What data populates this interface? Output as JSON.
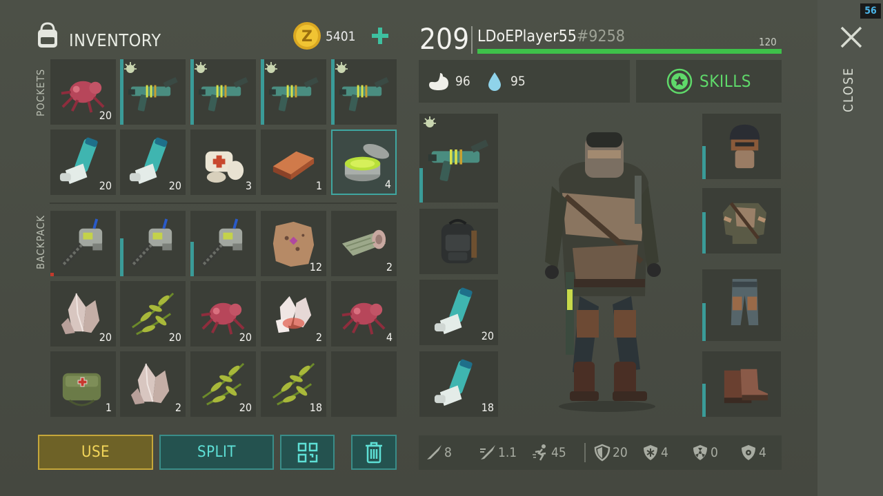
{
  "inventory": {
    "title": "INVENTORY",
    "coins": "5401",
    "pockets_label": "POCKETS",
    "backpack_label": "BACKPACK",
    "pockets": [
      {
        "item": "spider-creature-icon",
        "count": "20"
      },
      {
        "item": "rifle-icon",
        "count": "",
        "level": true
      },
      {
        "item": "rifle-icon",
        "count": "",
        "level": true
      },
      {
        "item": "rifle-icon",
        "count": "",
        "level": true
      },
      {
        "item": "rifle-icon",
        "count": "",
        "level": true
      },
      {
        "item": "inhaler-icon",
        "count": "20"
      },
      {
        "item": "inhaler-icon",
        "count": "20"
      },
      {
        "item": "bandage-icon",
        "count": "3"
      },
      {
        "item": "copper-ingot-icon",
        "count": "1"
      },
      {
        "item": "ointment-jar-icon",
        "count": "4",
        "selected": true
      }
    ],
    "backpack": [
      {
        "item": "chainsaw-icon",
        "count": ""
      },
      {
        "item": "chainsaw-icon",
        "count": ""
      },
      {
        "item": "chainsaw-icon",
        "count": ""
      },
      {
        "item": "leather-hide-icon",
        "count": "12"
      },
      {
        "item": "fabric-roll-icon",
        "count": "2"
      },
      {
        "item": "quartz-crystal-icon",
        "count": "20"
      },
      {
        "item": "herb-bundle-icon",
        "count": "20"
      },
      {
        "item": "spider-creature-icon",
        "count": "20"
      },
      {
        "item": "salt-crystal-icon",
        "count": "2"
      },
      {
        "item": "spider-creature-icon",
        "count": "4"
      },
      {
        "item": "medkit-bag-icon",
        "count": "1"
      },
      {
        "item": "quartz-crystal-icon",
        "count": "2"
      },
      {
        "item": "herb-bundle-icon",
        "count": "20"
      },
      {
        "item": "herb-bundle-icon",
        "count": "18"
      },
      {
        "item": "empty",
        "count": ""
      }
    ]
  },
  "actions": {
    "use": "USE",
    "split": "SPLIT"
  },
  "player": {
    "level": "209",
    "name": "LDoEPlayer55",
    "tag": "#9258",
    "xp_label": "120",
    "xp_fraction": 1.0,
    "food": "96",
    "water": "95",
    "skills_label": "SKILLS"
  },
  "equipment": {
    "left": [
      {
        "item": "rifle-icon",
        "count": ""
      },
      {
        "item": "backpack-icon",
        "count": ""
      },
      {
        "item": "inhaler-icon",
        "count": "20"
      },
      {
        "item": "inhaler-icon",
        "count": "18"
      }
    ],
    "right": [
      "helmet-icon",
      "armored-jacket-icon",
      "armored-pants-icon",
      "boots-icon"
    ]
  },
  "stats": {
    "damage": "8",
    "attack_speed": "1.1",
    "speed": "45",
    "armor": "20",
    "cold": "4",
    "radiation": "0",
    "infection": "4"
  },
  "close_label": "CLOSE",
  "fps": "56",
  "colors": {
    "accent_teal": "#3a8d89",
    "accent_yellow": "#c6a73a",
    "xp_green": "#3ec14a",
    "skills_green": "#5fd96a"
  }
}
